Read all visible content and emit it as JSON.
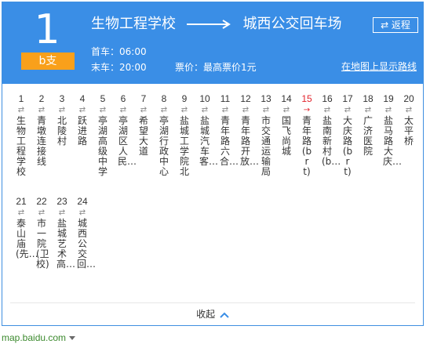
{
  "route": {
    "number": "1",
    "branch": "b支",
    "from": "生物工程学校",
    "to": "城西公交回车场",
    "return_label": "⇄ 返程",
    "first_bus": "首车：06:00",
    "last_bus": "末车：20:00",
    "fare": "票价：最高票价1元",
    "map_link": "在地图上显示路线"
  },
  "stops": [
    {
      "num": "1",
      "name": "生物工程学校",
      "current": false
    },
    {
      "num": "2",
      "name": "青墩连接线",
      "current": false
    },
    {
      "num": "3",
      "name": "北陵村",
      "current": false
    },
    {
      "num": "4",
      "name": "跃进路",
      "current": false
    },
    {
      "num": "5",
      "name": "亭湖高级中学",
      "current": false
    },
    {
      "num": "6",
      "name": "亭湖区人民…",
      "current": false
    },
    {
      "num": "7",
      "name": "希望大道",
      "current": false
    },
    {
      "num": "8",
      "name": "亭湖行政中心",
      "current": false
    },
    {
      "num": "9",
      "name": "盐城工学院北",
      "current": false
    },
    {
      "num": "10",
      "name": "盐城汽车客…",
      "current": false
    },
    {
      "num": "11",
      "name": "青年路六合…",
      "current": false
    },
    {
      "num": "12",
      "name": "青年路开放…",
      "current": false
    },
    {
      "num": "13",
      "name": "市交通运输局",
      "current": false
    },
    {
      "num": "14",
      "name": "国飞尚城",
      "current": false
    },
    {
      "num": "15",
      "name": "青年路(brt)",
      "current": true
    },
    {
      "num": "16",
      "name": "盐南新村(b…",
      "current": false
    },
    {
      "num": "17",
      "name": "大庆路(brt)",
      "current": false
    },
    {
      "num": "18",
      "name": "广济医院",
      "current": false
    },
    {
      "num": "19",
      "name": "盐马路大庆…",
      "current": false
    },
    {
      "num": "20",
      "name": "太平桥",
      "current": false
    },
    {
      "num": "21",
      "name": "泰山庙(先…",
      "current": false
    },
    {
      "num": "22",
      "name": "市一院(卫校)",
      "current": false
    },
    {
      "num": "23",
      "name": "盐城艺术高…",
      "current": false
    },
    {
      "num": "24",
      "name": "城西公交回…",
      "current": false
    }
  ],
  "symbols": {
    "both": "⇄",
    "current": "→"
  },
  "collapse_label": "收起",
  "footer": "map.baidu.com",
  "colors": {
    "header_bg": "#3a8ee6",
    "branch_bg": "#f9a01b",
    "current_stop": "#e2242d",
    "footer_link": "#3c8a2e"
  }
}
